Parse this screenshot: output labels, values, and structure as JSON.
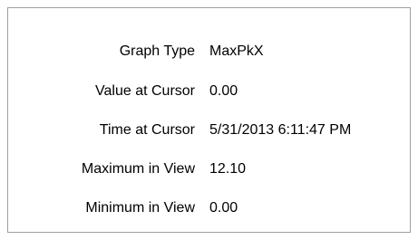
{
  "properties": [
    {
      "label": "Graph Type",
      "value": "MaxPkX"
    },
    {
      "label": "Value at Cursor",
      "value": "0.00"
    },
    {
      "label": "Time at Cursor",
      "value": "5/31/2013 6:11:47 PM"
    },
    {
      "label": "Maximum in View",
      "value": "12.10"
    },
    {
      "label": "Minimum in View",
      "value": "0.00"
    }
  ]
}
